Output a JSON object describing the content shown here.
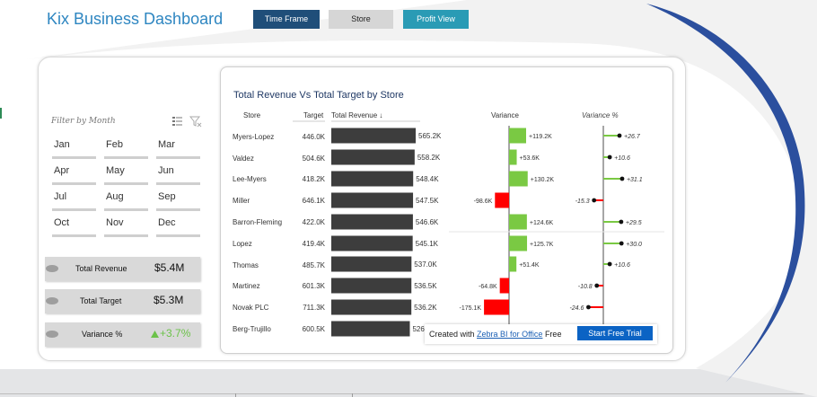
{
  "header": {
    "title": "Kix Business Dashboard",
    "nav": [
      {
        "label": "Time Frame",
        "active": true
      },
      {
        "label": "Store",
        "active": false
      },
      {
        "label": "Profit View",
        "active": false
      }
    ]
  },
  "filter": {
    "label": "Filter by Month",
    "icons": [
      "multi-select-icon",
      "clear-filter-icon"
    ],
    "months": [
      "Jan",
      "Feb",
      "Mar",
      "Apr",
      "May",
      "Jun",
      "Jul",
      "Aug",
      "Sep",
      "Oct",
      "Nov",
      "Dec"
    ]
  },
  "kpis": [
    {
      "label": "Total Revenue",
      "value": "$5.4M"
    },
    {
      "label": "Total Target",
      "value": "$5.3M"
    },
    {
      "label": "Variance %",
      "value": "+3.7%",
      "trend_icon": "triangle-up-icon"
    }
  ],
  "chart_data": {
    "type": "table",
    "title": "Total Revenue Vs Total Target by Store",
    "columns": {
      "store": "Store",
      "target": "Target",
      "revenue": "Total Revenue ↓",
      "variance": "Variance",
      "variance_pct": "Variance %"
    },
    "rows": [
      {
        "store": "Myers-Lopez",
        "target": "446.0K",
        "revenue": 565.2,
        "revenue_label": "565.2K",
        "variance": 119.2,
        "variance_label": "+119.2K",
        "variance_pct": 26.7,
        "variance_pct_label": "+26.7"
      },
      {
        "store": "Valdez",
        "target": "504.6K",
        "revenue": 558.2,
        "revenue_label": "558.2K",
        "variance": 53.6,
        "variance_label": "+53.6K",
        "variance_pct": 10.6,
        "variance_pct_label": "+10.6"
      },
      {
        "store": "Lee-Myers",
        "target": "418.2K",
        "revenue": 548.4,
        "revenue_label": "548.4K",
        "variance": 130.2,
        "variance_label": "+130.2K",
        "variance_pct": 31.1,
        "variance_pct_label": "+31.1"
      },
      {
        "store": "Miller",
        "target": "646.1K",
        "revenue": 547.5,
        "revenue_label": "547.5K",
        "variance": -98.6,
        "variance_label": "-98.6K",
        "variance_pct": -15.3,
        "variance_pct_label": "-15.3"
      },
      {
        "store": "Barron-Fleming",
        "target": "422.0K",
        "revenue": 546.6,
        "revenue_label": "546.6K",
        "variance": 124.6,
        "variance_label": "+124.6K",
        "variance_pct": 29.5,
        "variance_pct_label": "+29.5"
      },
      {
        "store": "Lopez",
        "target": "419.4K",
        "revenue": 545.1,
        "revenue_label": "545.1K",
        "variance": 125.7,
        "variance_label": "+125.7K",
        "variance_pct": 30.0,
        "variance_pct_label": "+30.0"
      },
      {
        "store": "Thomas",
        "target": "485.7K",
        "revenue": 537.0,
        "revenue_label": "537.0K",
        "variance": 51.4,
        "variance_label": "+51.4K",
        "variance_pct": 10.6,
        "variance_pct_label": "+10.6"
      },
      {
        "store": "Martinez",
        "target": "601.3K",
        "revenue": 536.5,
        "revenue_label": "536.5K",
        "variance": -64.8,
        "variance_label": "-64.8K",
        "variance_pct": -10.8,
        "variance_pct_label": "-10.8"
      },
      {
        "store": "Novak PLC",
        "target": "711.3K",
        "revenue": 536.2,
        "revenue_label": "536.2K",
        "variance": -175.1,
        "variance_label": "-175.1K",
        "variance_pct": -24.6,
        "variance_pct_label": "-24.6"
      },
      {
        "store": "Berg-Trujillo",
        "target": "600.5K",
        "revenue": 526.0,
        "revenue_label": "526",
        "variance": null,
        "variance_label": "",
        "variance_pct": null,
        "variance_pct_label": ""
      }
    ],
    "colors": {
      "revenue": "#3d3d3d",
      "positive": "#7ac943",
      "negative": "#ff0000",
      "axis": "#888888"
    }
  },
  "banner": {
    "prefix": "Created with",
    "link": "Zebra BI for Office",
    "suffix": "Free",
    "button": "Start Free Trial"
  }
}
